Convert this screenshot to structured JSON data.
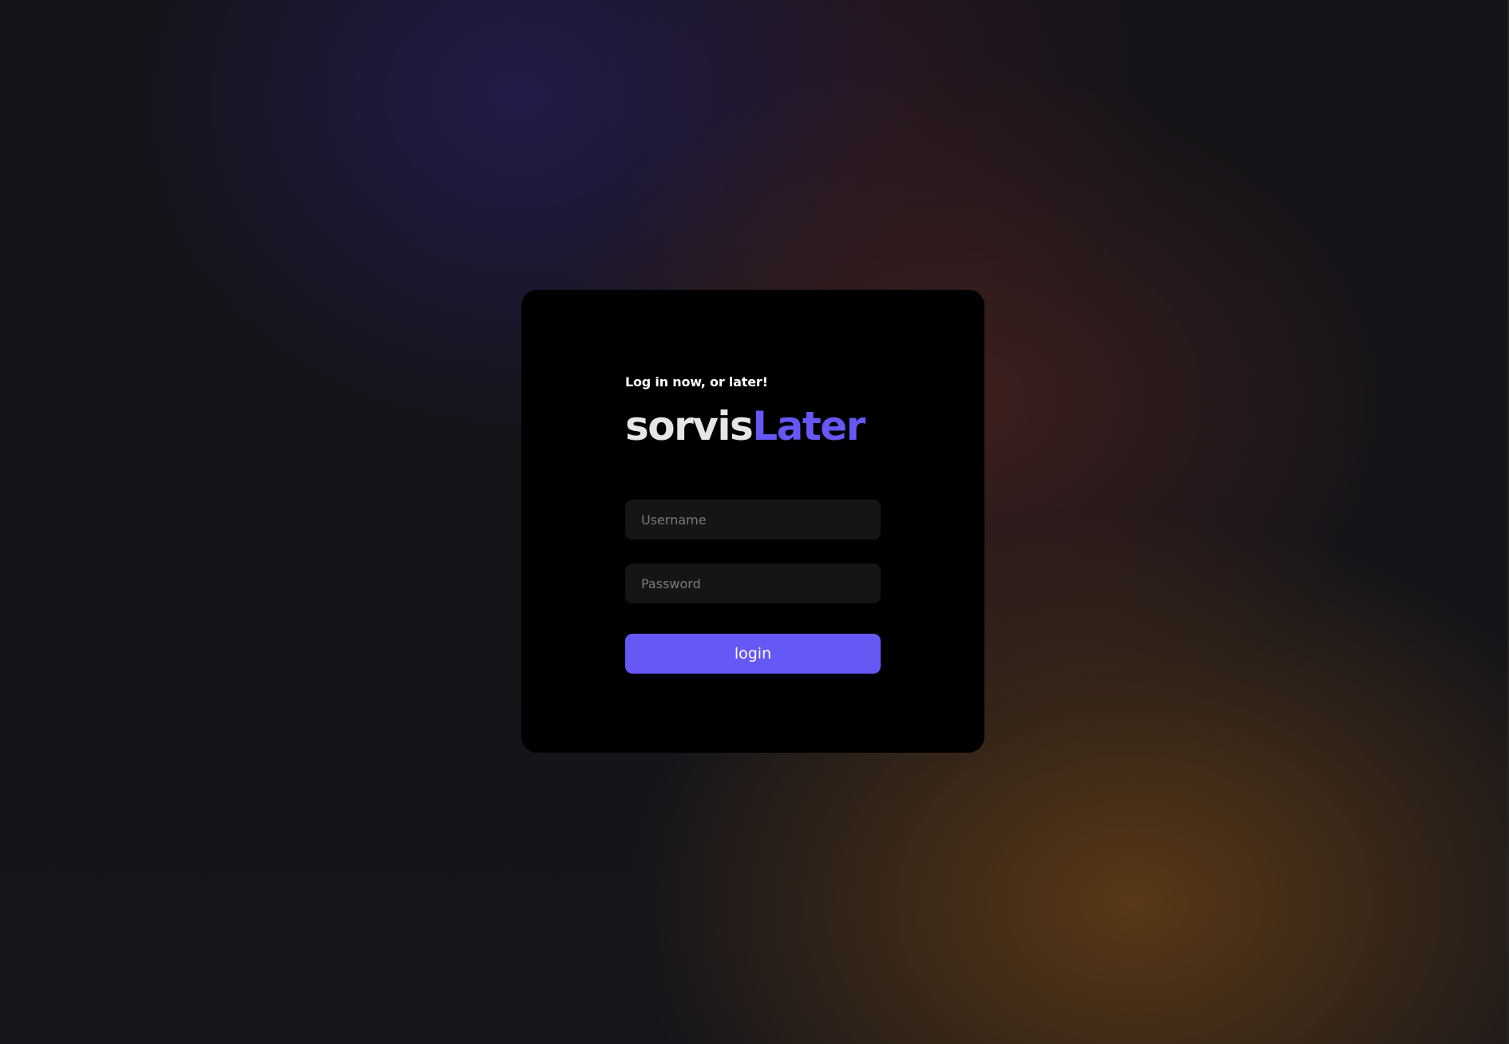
{
  "login": {
    "tagline": "Log in now, or later!",
    "brand": {
      "part1": "sorvis",
      "part2": "Later"
    },
    "username": {
      "placeholder": "Username",
      "value": ""
    },
    "password": {
      "placeholder": "Password",
      "value": ""
    },
    "submit_label": "login"
  },
  "colors": {
    "accent": "#6558f5",
    "card": "#000000",
    "input_bg": "#151515",
    "brand_primary": "#e6e6e6"
  }
}
